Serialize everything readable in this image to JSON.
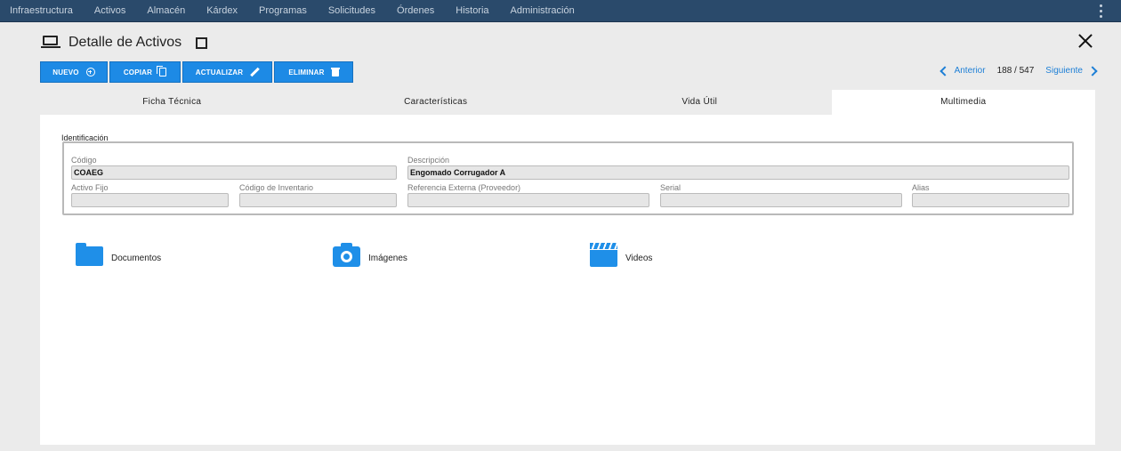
{
  "nav": {
    "items": [
      "Infraestructura",
      "Activos",
      "Almacén",
      "Kárdex",
      "Programas",
      "Solicitudes",
      "Órdenes",
      "Historia",
      "Administración"
    ]
  },
  "header": {
    "title": "Detalle de Activos"
  },
  "toolbar": {
    "nuevo": "NUEVO",
    "copiar": "COPIAR",
    "actualizar": "ACTUALIZAR",
    "eliminar": "ELIMINAR"
  },
  "pager": {
    "prev": "Anterior",
    "count": "188 / 547",
    "next": "Siguiente"
  },
  "tabs": [
    "Ficha Técnica",
    "Características",
    "Vida Útil",
    "Multimedia"
  ],
  "identificacion": {
    "section": "Identificación",
    "codigo": {
      "label": "Código",
      "value": "COAEG"
    },
    "descripcion": {
      "label": "Descripción",
      "value": "Engomado Corrugador A"
    },
    "activo_fijo": {
      "label": "Activo Fijo",
      "value": ""
    },
    "codigo_inventario": {
      "label": "Código de Inventario",
      "value": ""
    },
    "referencia_externa": {
      "label": "Referencia Externa (Proveedor)",
      "value": ""
    },
    "serial": {
      "label": "Serial",
      "value": ""
    },
    "alias": {
      "label": "Alias",
      "value": ""
    }
  },
  "multimedia": {
    "documentos": "Documentos",
    "imagenes": "Imágenes",
    "videos": "Videos"
  },
  "colors": {
    "nav_bg": "#2a4a6b",
    "accent": "#1d8ae5",
    "icon_blue": "#1f8fe8"
  }
}
